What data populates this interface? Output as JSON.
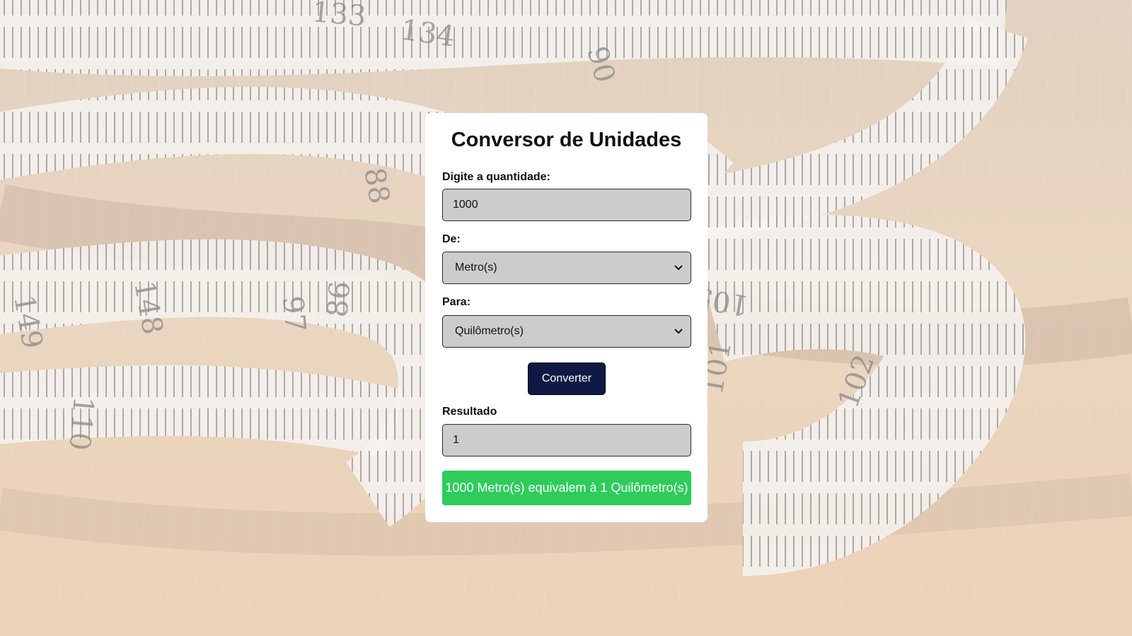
{
  "app": {
    "title": "Conversor de Unidades"
  },
  "form": {
    "quantity_label": "Digite a quantidade:",
    "quantity_value": "1000",
    "from_label": "De:",
    "from_selected": "Metro(s)",
    "to_label": "Para:",
    "to_selected": "Quilômetro(s)",
    "convert_label": "Converter",
    "result_label": "Resultado",
    "result_value": "1",
    "result_message": "1000 Metro(s) equivalem à 1 Quilômetro(s)"
  },
  "colors": {
    "button_bg": "#0e1a45",
    "message_bg": "#2ecc5b",
    "field_bg": "#cccccc"
  },
  "icons": {
    "select_arrow": "chevron-down-icon"
  }
}
